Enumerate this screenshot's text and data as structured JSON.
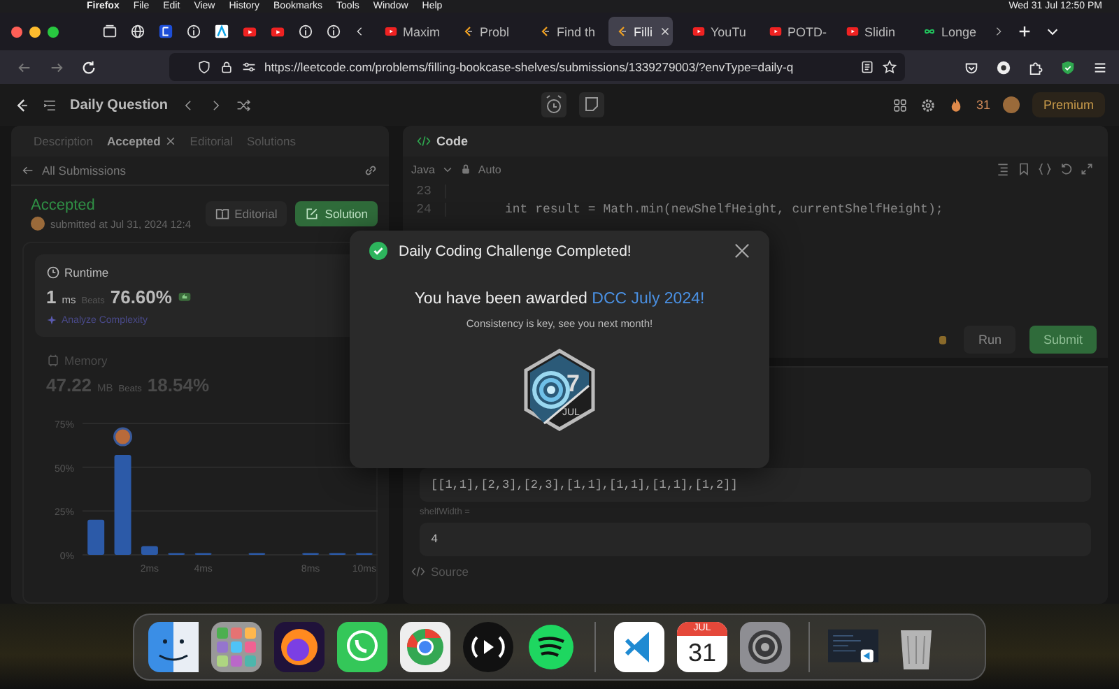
{
  "menu_bar": {
    "items": [
      "Firefox",
      "File",
      "Edit",
      "View",
      "History",
      "Bookmarks",
      "Tools",
      "Window",
      "Help"
    ],
    "clock": "Wed 31 Jul 12:50 PM"
  },
  "browser_tabs": [
    {
      "label": "Maxim",
      "kind": "video",
      "selected": false
    },
    {
      "label": "Probl",
      "kind": "code",
      "selected": false
    },
    {
      "label": "Find th",
      "kind": "code",
      "selected": false
    },
    {
      "label": "Filli",
      "kind": "code",
      "selected": true
    },
    {
      "label": "YouTu",
      "kind": "video",
      "selected": false
    },
    {
      "label": "POTD-",
      "kind": "video",
      "selected": false
    },
    {
      "label": "Slidin",
      "kind": "video",
      "selected": false
    },
    {
      "label": "Longe",
      "kind": "link",
      "selected": false
    }
  ],
  "url": "https://leetcode.com/problems/filling-bookcase-shelves/submissions/1339279003/?envType=daily-q",
  "header": {
    "title": "Daily Question",
    "streak": "31",
    "premium": "Premium"
  },
  "left_panel": {
    "tabs": [
      {
        "label": "Description",
        "selected": false
      },
      {
        "label": "Accepted",
        "selected": true
      },
      {
        "label": "Editorial",
        "selected": false
      },
      {
        "label": "Solutions",
        "selected": false
      }
    ],
    "back_link": "All Submissions",
    "status": "Accepted",
    "submitted": "submitted at Jul 31, 2024 12:4",
    "buttons": [
      "Editorial",
      "Solution"
    ],
    "runtime": {
      "title": "Runtime",
      "value": "1",
      "unit": "ms",
      "beats_label": "Beats",
      "beats": "76.60%",
      "link": "Analyze Complexity"
    },
    "memory": {
      "title": "Memory",
      "value": "47.22",
      "unit": "MB",
      "beats_label": "Beats",
      "beats": "18.54%"
    },
    "chart_data": {
      "type": "bar",
      "x": [
        0,
        1,
        2,
        3,
        4,
        6,
        8,
        9,
        10
      ],
      "values": [
        20,
        57,
        5,
        1,
        1,
        1,
        1,
        1,
        1
      ],
      "xlim": [
        -0.5,
        10.5
      ],
      "ylim": [
        0,
        75
      ],
      "yticks": [
        {
          "value": 0,
          "label": "0%"
        },
        {
          "value": 25,
          "label": "25%"
        },
        {
          "value": 50,
          "label": "50%"
        },
        {
          "value": 75,
          "label": "75%"
        }
      ],
      "xticks": [
        {
          "value": 2,
          "label": "2ms"
        },
        {
          "value": 4,
          "label": "4ms"
        },
        {
          "value": 8,
          "label": "8ms"
        },
        {
          "value": 10,
          "label": "10ms"
        }
      ]
    }
  },
  "code_panel": {
    "title": "Code",
    "language": "Java",
    "mode": "Auto",
    "lines": [
      {
        "number": "23"
      },
      {
        "number": "24",
        "code": "int result = Math.min(newShelfHeight, currentShelfHeight);"
      }
    ],
    "run": "Run",
    "submit": "Submit",
    "inputs": [
      {
        "value": "[[1,1],[2,3],[2,3],[1,1],[1,1],[1,1],[1,2]]"
      },
      {
        "label": "shelfWidth =",
        "value": "4"
      }
    ],
    "source": "Source"
  },
  "modal": {
    "title": "Daily Coding Challenge Completed!",
    "award_text": "You have been awarded",
    "award_name": "DCC July 2024!",
    "subtitle": "Consistency is key, see you next month!",
    "badge_day": "7",
    "badge_month": "JUL"
  },
  "dock": {
    "calendar_month": "JUL",
    "calendar_day": "31"
  }
}
